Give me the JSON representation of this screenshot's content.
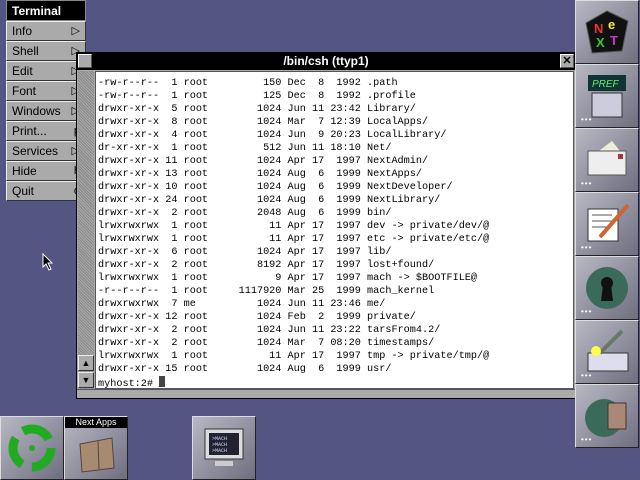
{
  "menu": {
    "title": "Terminal",
    "items": [
      {
        "label": "Info",
        "key": "▷"
      },
      {
        "label": "Shell",
        "key": "▷"
      },
      {
        "label": "Edit",
        "key": "▷"
      },
      {
        "label": "Font",
        "key": "▷"
      },
      {
        "label": "Windows",
        "key": "▷"
      },
      {
        "label": "Print...",
        "key": "p"
      },
      {
        "label": "Services",
        "key": "▷"
      },
      {
        "label": "Hide",
        "key": "h"
      },
      {
        "label": "Quit",
        "key": "q"
      }
    ]
  },
  "window": {
    "title": "/bin/csh (ttyp1)",
    "close": "✕",
    "lines": [
      "-rw-r--r--  1 root         150 Dec  8  1992 .path",
      "-rw-r--r--  1 root         125 Dec  8  1992 .profile",
      "drwxr-xr-x  5 root        1024 Jun 11 23:42 Library/",
      "drwxr-xr-x  8 root        1024 Mar  7 12:39 LocalApps/",
      "drwxr-xr-x  4 root        1024 Jun  9 20:23 LocalLibrary/",
      "dr-xr-xr-x  1 root         512 Jun 11 18:10 Net/",
      "drwxr-xr-x 11 root        1024 Apr 17  1997 NextAdmin/",
      "drwxr-xr-x 13 root        1024 Aug  6  1999 NextApps/",
      "drwxr-xr-x 10 root        1024 Aug  6  1999 NextDeveloper/",
      "drwxr-xr-x 24 root        1024 Aug  6  1999 NextLibrary/",
      "drwxr-xr-x  2 root        2048 Aug  6  1999 bin/",
      "lrwxrwxrwx  1 root          11 Apr 17  1997 dev -> private/dev/@",
      "lrwxrwxrwx  1 root          11 Apr 17  1997 etc -> private/etc/@",
      "drwxr-xr-x  6 root        1024 Apr 17  1997 lib/",
      "drwxr-xr-x  2 root        8192 Apr 17  1997 lost+found/",
      "lrwxrwxrwx  1 root           9 Apr 17  1997 mach -> $BOOTFILE@",
      "-r--r--r--  1 root     1117920 Mar 25  1999 mach_kernel",
      "drwxrwxrwx  7 me          1024 Jun 11 23:46 me/",
      "drwxr-xr-x 12 root        1024 Feb  2  1999 private/",
      "drwxr-xr-x  2 root        1024 Jun 11 23:22 tarsFrom4.2/",
      "drwxr-xr-x  2 root        1024 Mar  7 08:20 timestamps/",
      "lrwxrwxrwx  1 root          11 Apr 17  1997 tmp -> private/tmp/@",
      "drwxr-xr-x 15 root        1024 Aug  6  1999 usr/"
    ],
    "prompt": "myhost:2# "
  },
  "dock": {
    "logo_text": "NeXT",
    "pref_text": "PREF",
    "dots": "•••"
  },
  "shelf": {
    "folder_label": "Next Apps",
    "mach_text": ">MACH"
  }
}
